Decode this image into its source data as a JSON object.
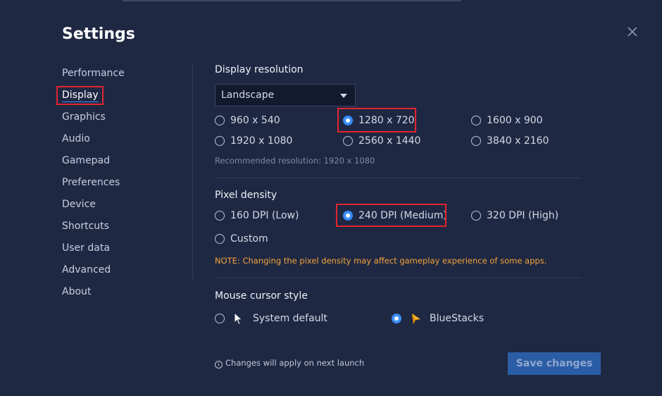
{
  "window": {
    "title": "Settings"
  },
  "sidebar": {
    "items": [
      {
        "label": "Performance"
      },
      {
        "label": "Display"
      },
      {
        "label": "Graphics"
      },
      {
        "label": "Audio"
      },
      {
        "label": "Gamepad"
      },
      {
        "label": "Preferences"
      },
      {
        "label": "Device"
      },
      {
        "label": "Shortcuts"
      },
      {
        "label": "User data"
      },
      {
        "label": "Advanced"
      },
      {
        "label": "About"
      }
    ],
    "active": "Display"
  },
  "display_resolution": {
    "title": "Display resolution",
    "orientation": "Landscape",
    "options": [
      "960 x 540",
      "1280 x 720",
      "1600 x 900",
      "1920 x 1080",
      "2560 x 1440",
      "3840 x 2160"
    ],
    "selected": "1280 x 720",
    "recommended": "Recommended resolution: 1920 x 1080"
  },
  "pixel_density": {
    "title": "Pixel density",
    "options": [
      "160 DPI (Low)",
      "240 DPI (Medium)",
      "320 DPI (High)",
      "Custom"
    ],
    "selected": "240 DPI (Medium)",
    "note": "NOTE: Changing the pixel density may affect gameplay experience of some apps."
  },
  "mouse_cursor": {
    "title": "Mouse cursor style",
    "options": [
      "System default",
      "BlueStacks"
    ],
    "selected": "BlueStacks"
  },
  "footer": {
    "info": "Changes will apply on next launch",
    "save_label": "Save changes"
  },
  "colors": {
    "background": "#1f2843",
    "accent": "#3a8ef6",
    "highlight": "#e0262f",
    "note": "#f2a33a",
    "save_bg": "#2b5da6"
  }
}
